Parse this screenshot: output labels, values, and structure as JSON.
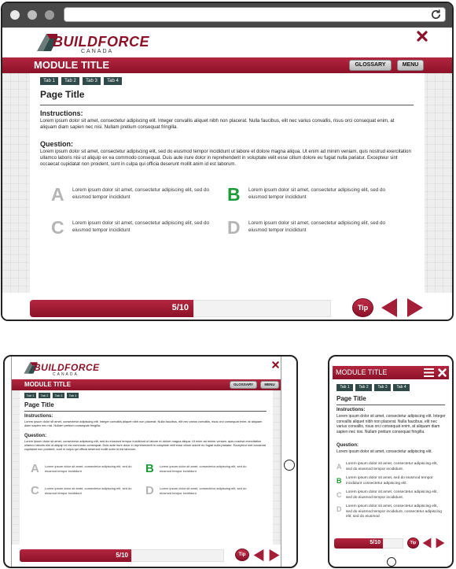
{
  "logo": {
    "name": "BUILDFORCE",
    "sub": "CANADA"
  },
  "module_title": "MODULE TITLE",
  "glossary_label": "GLOSSARY",
  "menu_label": "MENU",
  "tabs": [
    "Tab 1",
    "Tab 2",
    "Tab 3",
    "Tab 4"
  ],
  "page_title": "Page Title",
  "instructions": {
    "heading": "Instructions:",
    "text": "Lorem ipsum dolor sit amet, consectetur adipiscing elit. Integer convallis aliquet nibh non placerat. Nulla faucibus, elit nec varius convallis, risus orci consequat enim, at aliquam diam sapien nec nisi. Nullam pretium consequat fringilla."
  },
  "question": {
    "heading": "Question:",
    "text": "Lorem ipsum dolor sit amet, consectetur adipiscing elit, sed do eiusmod tempor incididunt ut labore et dolore magna aliqua. Ut enim ad minim veniam, quis nostrud exercitation ullamco laboris nisi ut aliquip ex ea commodo consequat. Duis aute irure dolor in reprehenderit in voluptate velit esse cillum dolore eu fugiat nulla pariatur. Excepteur sint occaecat cupidatat non proident, sunt in culpa qui officia deserunt mollit anim id est laborum.",
    "short_text": "Lorem ipsum dolor sit amet, consectetur adipiscing elit."
  },
  "options": [
    {
      "letter": "A",
      "text": "Lorem ipsum dolor sit amet, consectetur adipiscing elit, sed do eiusmod tempor incididunt",
      "correct": false
    },
    {
      "letter": "B",
      "text": "Lorem ipsum dolor sit amet, consectetur adipiscing elit, sed do eiusmod tempor incididunt",
      "correct": true
    },
    {
      "letter": "C",
      "text": "Lorem ipsum dolor sit amet, consectetur adipiscing elit, sed do eiusmod tempor incididunt",
      "correct": false
    },
    {
      "letter": "D",
      "text": "Lorem ipsum dolor sit amet, consectetur adipiscing elit, sed do eiusmod tempor incididunt",
      "correct": false
    }
  ],
  "phone_options": [
    {
      "letter": "A",
      "text": "Lorem ipsum dolor sit amet, consectetur adipiscing elit, sed do eiusmod tempor incididunt."
    },
    {
      "letter": "B",
      "text": "Lorem ipsum dolor sit amet, sed do eiusmod tempor incididunt consectetur adipiscing elit."
    },
    {
      "letter": "C",
      "text": "Lorem ipsum dolor sit amet, consectetur adipiscing elit, sed do eiusmod tempor incididunt."
    },
    {
      "letter": "D",
      "text": "Lorem ipsum dolor sit amet, consectetur adipiscing elit, sed do eiusmod tempor incididunt. consectetur adipiscing elit, sed do eiusmod"
    }
  ],
  "progress": "5/10",
  "tip_label": "Tip",
  "colors": {
    "maroon": "#9e1a33",
    "tab": "#2f4a48",
    "correct": "#1c9b36",
    "letter": "#b5b5b5"
  },
  "icons": [
    "refresh-icon",
    "close-icon",
    "hamburger-icon",
    "prev-arrow-icon",
    "next-arrow-icon",
    "logo-icon"
  ]
}
